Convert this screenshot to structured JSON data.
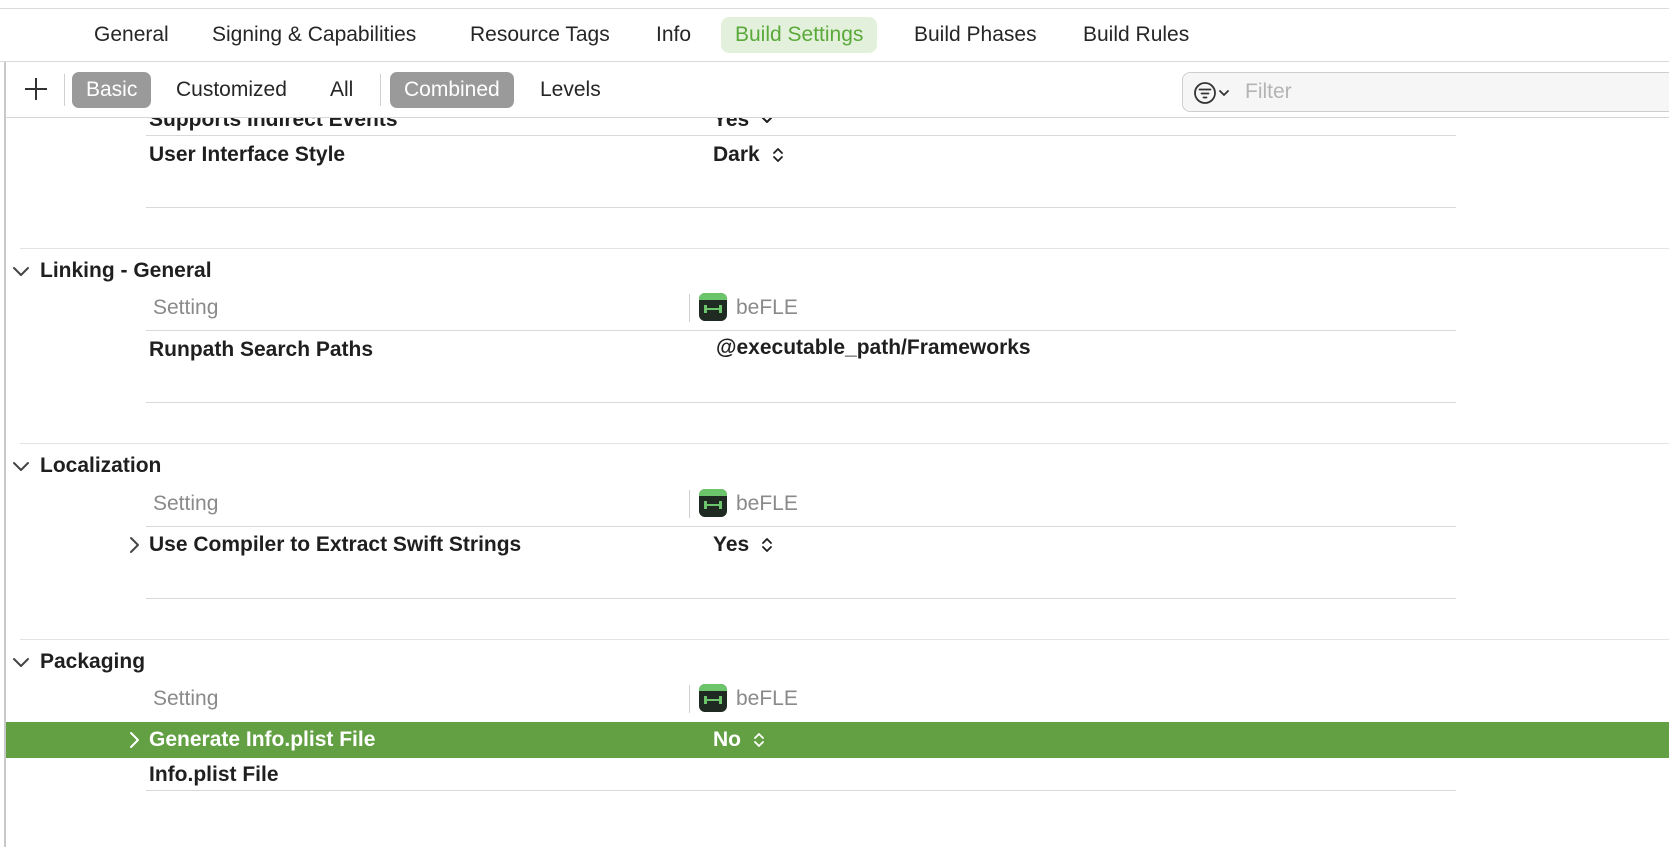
{
  "tabs": [
    {
      "label": "General"
    },
    {
      "label": "Signing & Capabilities"
    },
    {
      "label": "Resource Tags"
    },
    {
      "label": "Info"
    },
    {
      "label": "Build Settings",
      "active": true
    },
    {
      "label": "Build Phases"
    },
    {
      "label": "Build Rules"
    }
  ],
  "toolbar": {
    "add_icon": "plus-icon",
    "basic": "Basic",
    "customized": "Customized",
    "all": "All",
    "combined": "Combined",
    "levels": "Levels",
    "filter_placeholder": "Filter",
    "filter_icon": "filter-icon"
  },
  "colors": {
    "accent": "#5aa93a",
    "active_tab_bg": "#e3f1dc",
    "selected_row": "#63a043",
    "segment_selected": "#9a9a9a"
  },
  "partial_section": {
    "rows": [
      {
        "name": "Supports Indirect Events",
        "value": "Yes"
      },
      {
        "name": "User Interface Style",
        "value": "Dark"
      }
    ]
  },
  "sections": [
    {
      "title": "Linking - General",
      "header": {
        "setting": "Setting",
        "target": "beFLE"
      },
      "rows": [
        {
          "name": "Runpath Search Paths",
          "value": "@executable_path/Frameworks"
        }
      ]
    },
    {
      "title": "Localization",
      "header": {
        "setting": "Setting",
        "target": "beFLE"
      },
      "rows": [
        {
          "name": "Use Compiler to Extract Swift Strings",
          "value": "Yes"
        }
      ]
    },
    {
      "title": "Packaging",
      "header": {
        "setting": "Setting",
        "target": "beFLE"
      },
      "rows": [
        {
          "name": "Generate Info.plist File",
          "value": "No",
          "selected": true
        },
        {
          "name": "Info.plist File",
          "value": ""
        }
      ]
    }
  ]
}
